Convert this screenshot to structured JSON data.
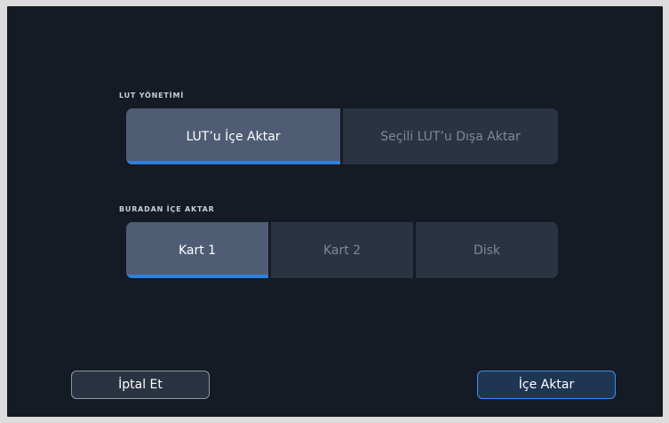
{
  "lut_management": {
    "label": "LUT YÖNETİMİ",
    "options": [
      "LUT’u İçe Aktar",
      "Seçili LUT’u Dışa Aktar"
    ],
    "selected": "LUT’u İçe Aktar"
  },
  "import_from": {
    "label": "BURADAN İÇE AKTAR",
    "options": [
      "Kart 1",
      "Kart 2",
      "Disk"
    ],
    "selected": "Kart 1"
  },
  "footer": {
    "cancel_label": "İptal Et",
    "import_label": "İçe Aktar"
  },
  "colors": {
    "background": "#151b25",
    "selected_button": "#4e5d73",
    "unselected_button": "#2a3342",
    "accent_blue": "#2f80e0"
  }
}
